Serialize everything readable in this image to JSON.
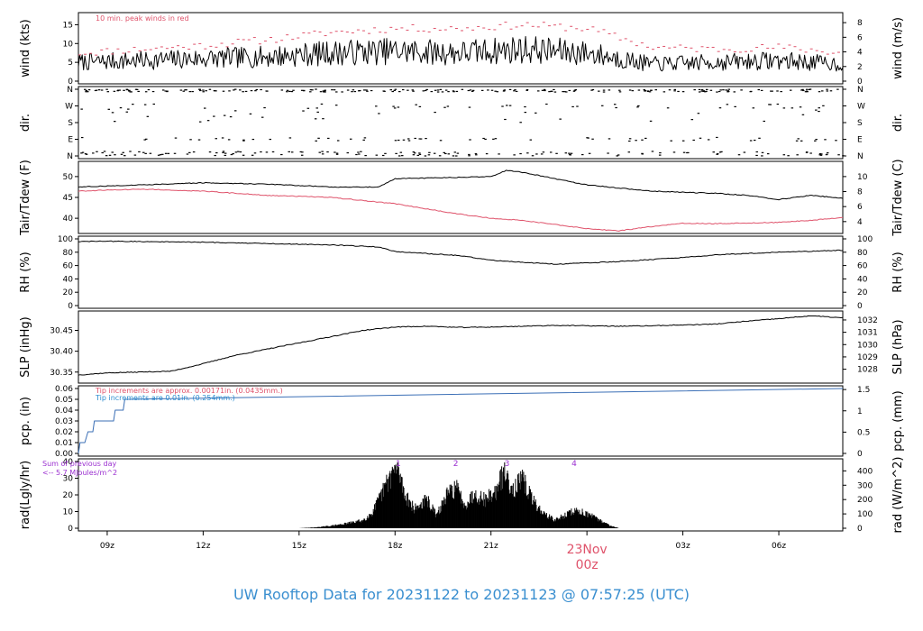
{
  "title": "UW Rooftop Data for 20231122  to  20231123 @ 07:57:25  (UTC)",
  "colors": {
    "title": "#3a8fd0",
    "red": "#df536b",
    "blue": "#2e8ecf",
    "purple": "#9b30d0",
    "black": "#000000",
    "pcp_line": "#3b6fb6"
  },
  "time_axis": {
    "range_hours": [
      8.1,
      32.0
    ],
    "tick_labels": [
      "09z",
      "12z",
      "15z",
      "18z",
      "21z",
      "03z",
      "06z"
    ],
    "tick_hours": [
      9,
      12,
      15,
      18,
      21,
      27,
      30
    ],
    "date_label": "23Nov",
    "date_sublabel": "00z",
    "date_hour": 24
  },
  "chart_data": [
    {
      "type": "line",
      "id": "wind",
      "ylabel_left": "wind (kts)",
      "ylabel_right": "wind (m/s)",
      "yticks_left": [
        "0",
        "5",
        "10",
        "15"
      ],
      "yticks_right": [
        "0",
        "2",
        "4",
        "6",
        "8"
      ],
      "ylim": [
        0,
        17.5
      ],
      "annotation": "10 min. peak winds in red",
      "series": [
        {
          "name": "wind",
          "color": "black",
          "knots_x": [
            8.1,
            10,
            12,
            14,
            16,
            18,
            20,
            22,
            24,
            26,
            28,
            30,
            32
          ],
          "knots_y": [
            5,
            5.5,
            6,
            6.5,
            7.5,
            8,
            7.5,
            8.5,
            7.5,
            4.5,
            5,
            5.5,
            4.5
          ]
        },
        {
          "name": "peak winds",
          "color": "red",
          "style": "dashes",
          "knots_x": [
            8.1,
            10,
            12,
            14,
            16,
            18,
            20,
            22,
            24,
            26,
            28,
            30,
            32
          ],
          "knots_y": [
            7.5,
            8.5,
            9.5,
            11,
            13,
            14,
            14,
            15,
            14,
            9,
            8.5,
            9,
            7.5
          ]
        }
      ]
    },
    {
      "type": "scatter",
      "id": "dir",
      "ylabel_left": "dir.",
      "ylabel_right": "dir.",
      "yticks_left": [
        "N",
        "E",
        "S",
        "W",
        "N"
      ],
      "yticks_right": [
        "N",
        "E",
        "S",
        "W",
        "N"
      ],
      "ylim": [
        0,
        360
      ]
    },
    {
      "type": "line",
      "id": "temp",
      "ylabel_left": "Tair/Tdew (F)",
      "ylabel_right": "Tair/Tdew (C)",
      "yticks_left": [
        "40",
        "45",
        "50"
      ],
      "yticks_right": [
        "4",
        "6",
        "8",
        "10"
      ],
      "ylim": [
        37,
        53
      ],
      "series": [
        {
          "name": "Tair",
          "color": "black",
          "x": [
            8.1,
            10,
            12,
            14,
            16,
            17.5,
            18,
            20,
            21,
            21.5,
            22,
            23,
            24,
            26,
            28,
            29,
            30,
            31,
            32
          ],
          "y": [
            47.5,
            48,
            48.5,
            48.2,
            47.5,
            47.5,
            49.5,
            49.8,
            50,
            51.5,
            51,
            49.5,
            48,
            46.5,
            46,
            45.5,
            44.5,
            45.5,
            44.8
          ]
        },
        {
          "name": "Tdew",
          "color": "red",
          "x": [
            8.1,
            10,
            12,
            14,
            16,
            18,
            20,
            21,
            22,
            23,
            24,
            25,
            26,
            27,
            28,
            30,
            31,
            32
          ],
          "y": [
            46.5,
            47,
            46.5,
            45.5,
            45,
            43.5,
            41,
            40,
            39.5,
            38.5,
            37.5,
            37,
            38,
            38.8,
            38.7,
            39,
            39.5,
            40.2
          ]
        }
      ]
    },
    {
      "type": "line",
      "id": "rh",
      "ylabel_left": "RH (%)",
      "ylabel_right": "RH (%)",
      "yticks_left": [
        "0",
        "20",
        "40",
        "60",
        "80",
        "100"
      ],
      "yticks_right": [
        "0",
        "20",
        "40",
        "60",
        "80",
        "100"
      ],
      "ylim": [
        0,
        100
      ],
      "series": [
        {
          "name": "RH",
          "color": "black",
          "x": [
            8.1,
            9,
            10,
            12,
            14,
            16,
            17.5,
            18,
            20,
            21,
            22,
            23,
            24,
            25,
            27,
            28,
            30,
            32
          ],
          "y": [
            96,
            96.5,
            96,
            95,
            93,
            91,
            88,
            81,
            75,
            68,
            65,
            62,
            64,
            66,
            72,
            76,
            80,
            83
          ]
        }
      ]
    },
    {
      "type": "line",
      "id": "slp",
      "ylabel_left": "SLP (inHg)",
      "ylabel_right": "SLP (hPa)",
      "yticks_left": [
        "30.35",
        "30.40",
        "30.45"
      ],
      "yticks_right": [
        "1028",
        "1029",
        "1030",
        "1031",
        "1032"
      ],
      "ylim": [
        30.33,
        30.49
      ],
      "series": [
        {
          "name": "SLP",
          "color": "black",
          "x": [
            8.1,
            9,
            10,
            11,
            12,
            13,
            14,
            15,
            16,
            17,
            18,
            19,
            20,
            21,
            22,
            23,
            24,
            25,
            26,
            27,
            28,
            29,
            30,
            31,
            32
          ],
          "y": [
            30.343,
            30.348,
            30.35,
            30.352,
            30.37,
            30.39,
            30.405,
            30.42,
            30.435,
            30.45,
            30.458,
            30.46,
            30.457,
            30.458,
            30.46,
            30.462,
            30.461,
            30.46,
            30.461,
            30.463,
            30.465,
            30.472,
            30.478,
            30.485,
            30.48
          ]
        }
      ]
    },
    {
      "type": "line",
      "id": "pcp",
      "ylabel_left": "pcp. (in)",
      "ylabel_right": "pcp. (mm)",
      "yticks_left": [
        "0.00",
        "0.01",
        "0.02",
        "0.03",
        "0.04",
        "0.05",
        "0.06"
      ],
      "yticks_right": [
        "0",
        "0.5",
        "1",
        "1.5"
      ],
      "ylim": [
        0,
        0.06
      ],
      "annotation_red": "Tip increments are approx. 0.00171in. (0.0435mm.)",
      "annotation_blue": "Tip increments are 0.01in. (0.254mm.)",
      "series": [
        {
          "name": "pcp",
          "color": "pcp_line",
          "x": [
            8.1,
            8.15,
            8.3,
            8.4,
            8.55,
            8.6,
            9.2,
            9.25,
            9.5,
            9.55,
            32
          ],
          "y": [
            0,
            0.01,
            0.01,
            0.02,
            0.02,
            0.03,
            0.03,
            0.04,
            0.04,
            0.05,
            0.06
          ]
        }
      ]
    },
    {
      "type": "area",
      "id": "rad",
      "ylabel_left": "rad(Lgly/hr)",
      "ylabel_right": "rad (W/m^2)",
      "yticks_left": [
        "0",
        "10",
        "20",
        "30",
        "40"
      ],
      "yticks_right": [
        "0",
        "100",
        "200",
        "300",
        "400"
      ],
      "ylim": [
        0,
        40
      ],
      "annotation_line1": "Sum of previous day",
      "annotation_line2": "<-- 5.7 MJoules/m^2",
      "markers": [
        {
          "label": "1",
          "x": 18.1
        },
        {
          "label": "2",
          "x": 19.9
        },
        {
          "label": "3",
          "x": 21.5
        },
        {
          "label": "4",
          "x": 23.6
        }
      ],
      "series": [
        {
          "name": "rad",
          "color": "black",
          "knots_x": [
            15.0,
            15.5,
            16,
            16.5,
            17.0,
            17.3,
            17.6,
            17.9,
            18.1,
            18.3,
            18.6,
            19,
            19.3,
            19.6,
            19.9,
            20.2,
            20.5,
            20.8,
            21.2,
            21.4,
            21.7,
            22.0,
            22.3,
            22.6,
            23,
            23.3,
            23.6,
            23.9,
            24.3,
            24.7,
            25
          ],
          "knots_y": [
            0,
            0.5,
            1.5,
            3,
            5,
            10,
            22,
            35,
            38,
            22,
            12,
            18,
            8,
            20,
            26,
            15,
            22,
            18,
            24,
            36,
            25,
            30,
            18,
            10,
            5,
            8,
            11,
            10,
            6,
            2,
            0
          ]
        }
      ]
    }
  ]
}
